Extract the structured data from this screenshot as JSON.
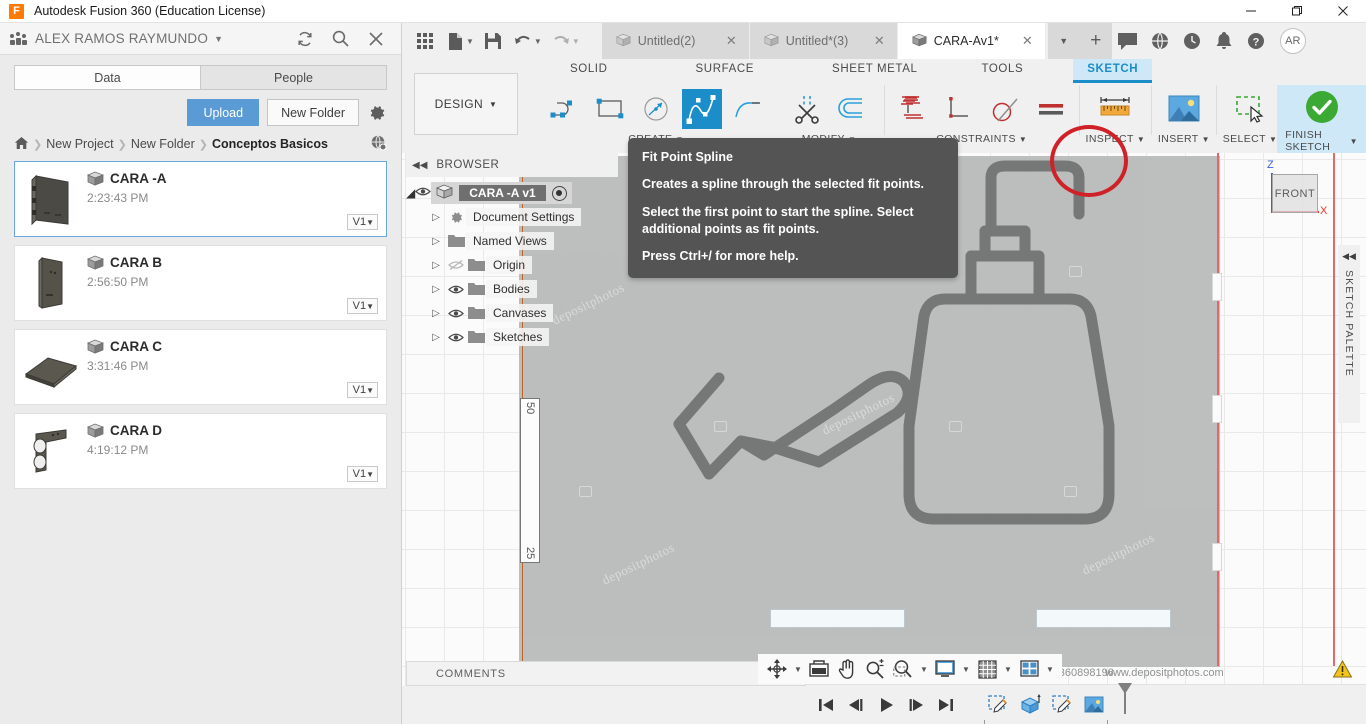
{
  "window": {
    "app_title": "Autodesk Fusion 360 (Education License)",
    "logo_letter": "F",
    "minimize": "—",
    "maximize": "❐",
    "close": "✕"
  },
  "account_bar": {
    "user_name": "ALEX RAMOS RAYMUNDO",
    "caret": "▼",
    "icons": [
      "refresh-icon",
      "search-icon",
      "close-icon"
    ]
  },
  "data_panel": {
    "tabs": [
      {
        "label": "Data",
        "active": true
      },
      {
        "label": "People",
        "active": false
      }
    ],
    "upload_label": "Upload",
    "new_folder_label": "New Folder",
    "breadcrumb": {
      "home": "home-icon",
      "items": [
        "New Project",
        "New Folder",
        "Conceptos Basicos"
      ],
      "separator": "❯"
    },
    "files": [
      {
        "name": "CARA -A",
        "time": "2:23:43 PM",
        "version": "V1",
        "selected": true
      },
      {
        "name": "CARA B",
        "time": "2:56:50 PM",
        "version": "V1",
        "selected": false
      },
      {
        "name": "CARA C",
        "time": "3:31:46 PM",
        "version": "V1",
        "selected": false
      },
      {
        "name": "CARA D",
        "time": "4:19:12 PM",
        "version": "V1",
        "selected": false
      }
    ]
  },
  "quick_access": {
    "icons": [
      "grid-apps-icon",
      "new-file-icon",
      "save-icon",
      "undo-icon",
      "redo-icon"
    ]
  },
  "doc_tabs": [
    {
      "label": "Untitled(2)",
      "active": false,
      "close": "✕"
    },
    {
      "label": "Untitled*(3)",
      "active": false,
      "close": "✕"
    },
    {
      "label": "CARA-Av1*",
      "active": true,
      "close": "✕"
    }
  ],
  "tabs_right": {
    "dropdown": "▼",
    "plus": "+",
    "icons": [
      "comment-icon",
      "globe-icon",
      "job-status-icon",
      "notification-bell-icon",
      "help-icon"
    ],
    "avatar_initials": "AR"
  },
  "ribbon": {
    "workspace_label": "DESIGN",
    "workspace_caret": "▼",
    "tabs": [
      {
        "label": "SOLID",
        "active": false
      },
      {
        "label": "SURFACE",
        "active": false
      },
      {
        "label": "SHEET METAL",
        "active": false
      },
      {
        "label": "TOOLS",
        "active": false
      },
      {
        "label": "SKETCH",
        "active": true
      }
    ],
    "groups": [
      {
        "label": "CREATE",
        "caret": "▼",
        "tools": [
          "line-icon",
          "rectangle-icon",
          "circle-icon",
          "fit-point-spline-icon",
          "arc-icon"
        ]
      },
      {
        "label": "MODIFY",
        "caret": "▼",
        "tools": [
          "trim-icon",
          "offset-icon"
        ]
      },
      {
        "label": "CONSTRAINTS",
        "caret": "▼",
        "tools": [
          "fix-constraint-icon",
          "perpendicular-icon",
          "tangent-icon",
          "equal-icon"
        ]
      },
      {
        "label": "INSPECT",
        "caret": "▼",
        "tools": [
          "measure-icon"
        ]
      },
      {
        "label": "INSERT",
        "caret": "▼",
        "tools": [
          "insert-image-icon"
        ]
      },
      {
        "label": "SELECT",
        "caret": "▼",
        "tools": [
          "select-window-icon"
        ]
      },
      {
        "label": "FINISH SKETCH",
        "caret": "▼",
        "tools": [
          "finish-sketch-check-icon"
        ]
      }
    ]
  },
  "tooltip": {
    "title": "Fit Point Spline",
    "body1": "Creates a spline through the selected fit points.",
    "body2": "Select the first point to start the spline. Select additional points as fit points.",
    "body3": "Press Ctrl+/ for more help."
  },
  "browser": {
    "header": "BROWSER",
    "collapse_icon": "◀◀",
    "root": {
      "label": "CARA -A v1",
      "visible": true
    },
    "nodes": [
      {
        "label": "Document Settings",
        "icon": "gear-icon",
        "eye": false,
        "eye_off": false
      },
      {
        "label": "Named Views",
        "icon": "folder-icon",
        "eye": false,
        "eye_off": false
      },
      {
        "label": "Origin",
        "icon": "folder-icon",
        "eye": true,
        "eye_off": true
      },
      {
        "label": "Bodies",
        "icon": "folder-icon",
        "eye": true,
        "eye_off": false
      },
      {
        "label": "Canvases",
        "icon": "folder-icon",
        "eye": true,
        "eye_off": false
      },
      {
        "label": "Sketches",
        "icon": "folder-icon",
        "eye": true,
        "eye_off": false
      }
    ],
    "expand_arrow": "▷"
  },
  "canvas": {
    "ruler_top_label": "50",
    "ruler_bottom_label": "25",
    "watermark_text": "depositphotos",
    "view_cube": {
      "face": "FRONT",
      "z_label": "Z",
      "x_label": "X"
    },
    "sketch_palette": {
      "label": "SKETCH PALETTE",
      "collapse": "◀◀"
    }
  },
  "comments_bar": {
    "label": "COMMENTS",
    "add_icon": "add-comment-icon"
  },
  "nav_bar": {
    "icons": [
      "orbit-icon",
      "display-settings-icon",
      "pan-icon",
      "zoom-icon",
      "fit-icon",
      "display-mode-icon",
      "grid-snap-icon",
      "viewports-icon"
    ],
    "caret": "▼"
  },
  "status_bar": {
    "image_id_label": "Image ID: 360898196",
    "site": "www.depositphotos.com",
    "warning_icon": "warning-icon"
  },
  "timeline": {
    "icons": [
      "go-to-beginning-icon",
      "step-back-icon",
      "play-icon",
      "step-forward-icon",
      "go-to-end-icon"
    ],
    "feature_icons": [
      "sketch-feature-icon",
      "extrude-feature-icon",
      "sketch2-feature-icon",
      "canvas-feature-icon"
    ],
    "marker": "timeline-marker-icon",
    "settings": "gear-icon"
  },
  "colors": {
    "accent_blue": "#1b8ec9",
    "highlight_blue": "#cfe8f7",
    "upload_blue": "#5b9bd5",
    "red_circle": "#cf2128",
    "tooltip_bg": "#545454",
    "green_check": "#3aaa35"
  }
}
